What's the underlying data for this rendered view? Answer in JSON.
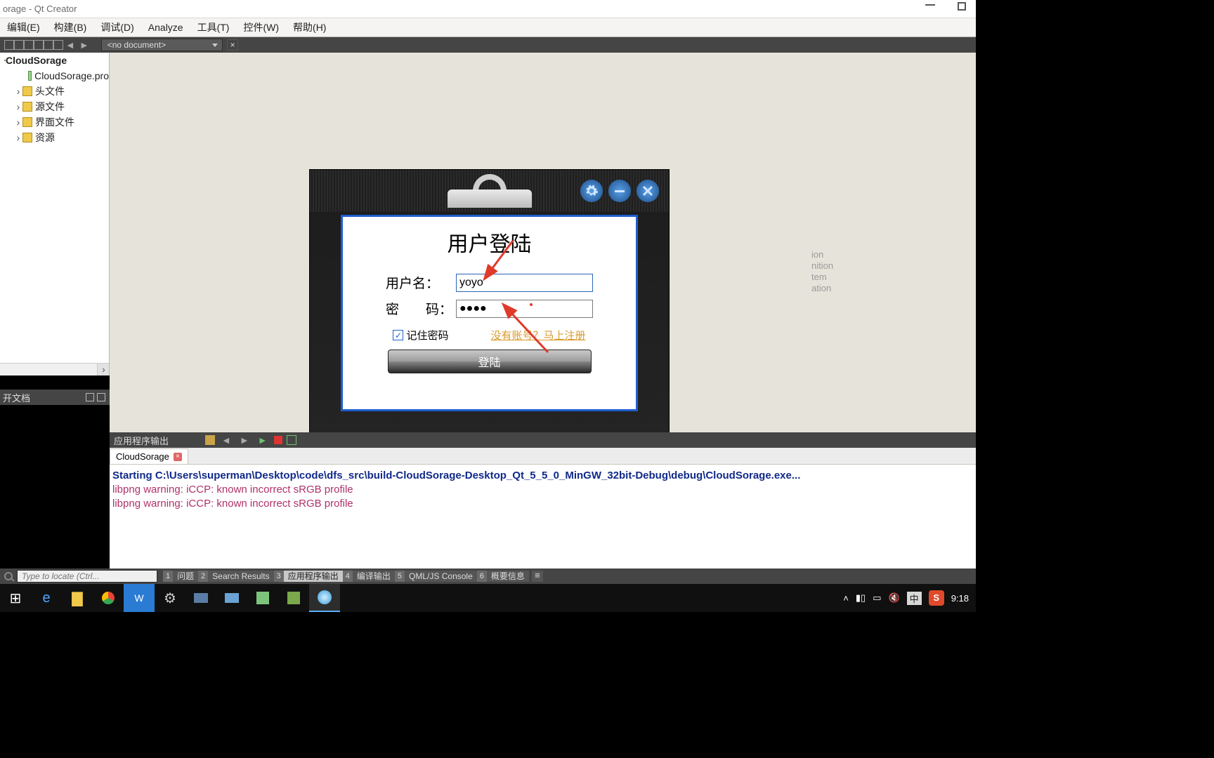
{
  "window": {
    "title": "orage - Qt Creator"
  },
  "menus": [
    "编辑(E)",
    "构建(B)",
    "调试(D)",
    "Analyze",
    "工具(T)",
    "控件(W)",
    "帮助(H)"
  ],
  "subbar": {
    "doc_combo": "<no document>"
  },
  "project": {
    "root": "CloudSorage",
    "pro_file": "CloudSorage.pro",
    "folders": [
      "头文件",
      "源文件",
      "界面文件",
      "资源"
    ]
  },
  "open_docs_label": "开文档",
  "login": {
    "title": "用户登陆",
    "user_label": "用户名：",
    "user_value": "yoyo",
    "pass_label_a": "密",
    "pass_label_b": "码",
    "pass_value": "●●●●",
    "remember": "记住密码",
    "register_link": "没有账号？马上注册",
    "login_btn": "登陆"
  },
  "bg_code": [
    "ion",
    "nition",
    "tem",
    "ation"
  ],
  "output_tab_title": "应用程序输出",
  "output_doc_tab": "CloudSorage",
  "console": {
    "line1": "Starting C:\\Users\\superman\\Desktop\\code\\dfs_src\\build-CloudSorage-Desktop_Qt_5_5_0_MinGW_32bit-Debug\\debug\\CloudSorage.exe...",
    "warn": "libpng warning: iCCP: known incorrect sRGB profile"
  },
  "locator": {
    "placeholder": "Type to locate (Ctrl...",
    "panes": [
      {
        "n": "1",
        "l": "问题"
      },
      {
        "n": "2",
        "l": "Search Results"
      },
      {
        "n": "3",
        "l": "应用程序输出"
      },
      {
        "n": "4",
        "l": "编译输出"
      },
      {
        "n": "5",
        "l": "QML/JS Console"
      },
      {
        "n": "6",
        "l": "概要信息"
      }
    ]
  },
  "tray": {
    "ime": "中",
    "clock": "9:18"
  }
}
